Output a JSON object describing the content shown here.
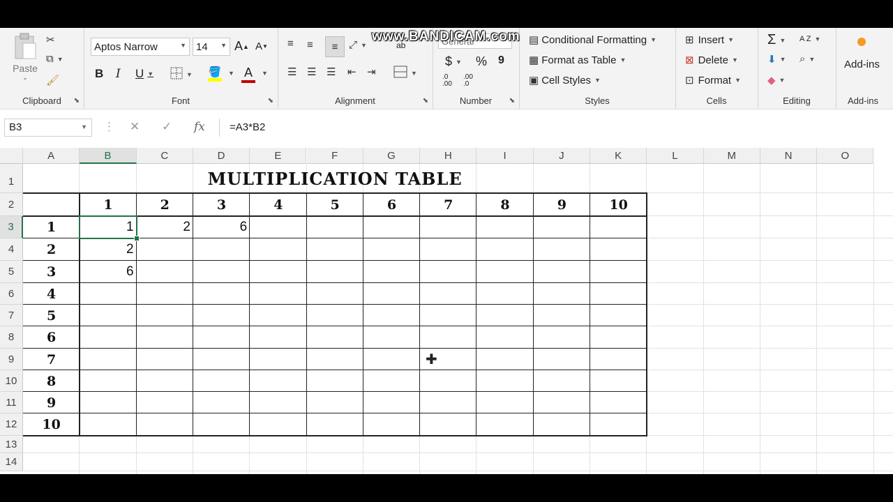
{
  "watermark": "www.BANDICAM.com",
  "ribbon": {
    "clipboard": {
      "label": "Clipboard",
      "paste": "Paste"
    },
    "font": {
      "label": "Font",
      "name": "Aptos Narrow",
      "size": "14",
      "bold": "B",
      "italic": "I",
      "underline": "U",
      "grow": "A",
      "shrink": "A",
      "font_color_letter": "A"
    },
    "alignment": {
      "label": "Alignment",
      "wrap_glyph": "ab"
    },
    "number": {
      "label": "Number",
      "format": "General",
      "currency": "$",
      "percent": "%",
      "comma": "9",
      "inc_dec": ".0\n.00",
      "dec_dec": ".00\n.0"
    },
    "styles": {
      "label": "Styles",
      "conditional": "Conditional Formatting",
      "format_table": "Format as Table",
      "cell_styles": "Cell Styles"
    },
    "cells": {
      "label": "Cells",
      "insert": "Insert",
      "delete": "Delete",
      "format": "Format"
    },
    "editing": {
      "label": "Editing",
      "sum": "Σ",
      "sort": "A Z"
    },
    "addins": {
      "label": "Add-ins",
      "button": "Add-ins"
    }
  },
  "formula_bar": {
    "name_box": "B3",
    "fx": "fx",
    "formula": "=A3*B2"
  },
  "sheet": {
    "columns": [
      "A",
      "B",
      "C",
      "D",
      "E",
      "F",
      "G",
      "H",
      "I",
      "J",
      "K",
      "L",
      "M",
      "N",
      "O"
    ],
    "rows": [
      "1",
      "2",
      "3",
      "4",
      "5",
      "6",
      "7",
      "8",
      "9",
      "10",
      "11",
      "12",
      "13",
      "14"
    ],
    "title": "MULTIPLICATION TABLE",
    "header_row": [
      "1",
      "2",
      "3",
      "4",
      "5",
      "6",
      "7",
      "8",
      "9",
      "10"
    ],
    "header_col": [
      "1",
      "2",
      "3",
      "4",
      "5",
      "6",
      "7",
      "8",
      "9",
      "10"
    ],
    "values": {
      "B3": "1",
      "C3": "2",
      "D3": "6",
      "B4": "2",
      "B5": "6"
    }
  },
  "colors": {
    "accent": "#217346",
    "font_color": "#c00000",
    "fill_color": "#ffff00",
    "addins_dot": "#f59a23"
  }
}
